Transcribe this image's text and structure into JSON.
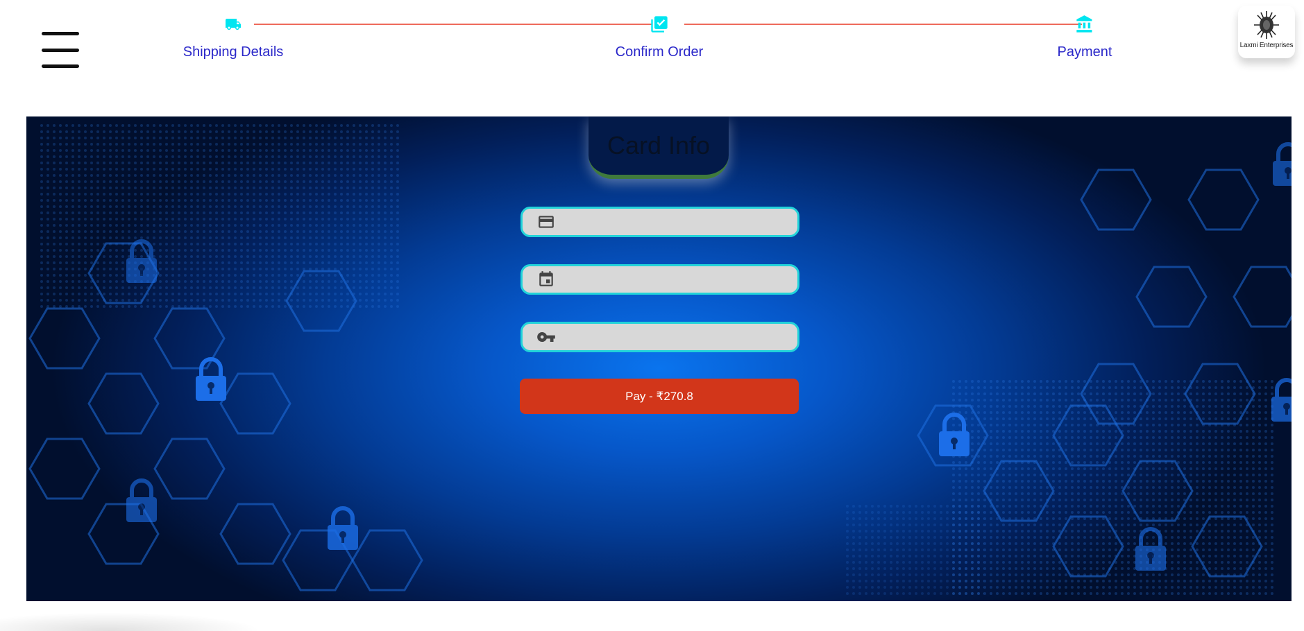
{
  "menu": {
    "icon": "hamburger-menu-icon"
  },
  "stepper": {
    "steps": [
      {
        "label": "Shipping Details",
        "icon": "truck-icon"
      },
      {
        "label": "Confirm Order",
        "icon": "checklist-icon"
      },
      {
        "label": "Payment",
        "icon": "bank-icon"
      }
    ],
    "accent_color": "#00e5f0",
    "label_color": "#2a27c9",
    "connector_color": "#ee6a5b"
  },
  "logo": {
    "text": "Laxmi Enterprises"
  },
  "card": {
    "title": "Card Info",
    "fields": [
      {
        "name": "card-number",
        "icon": "credit-card-icon",
        "value": "",
        "placeholder": ""
      },
      {
        "name": "card-expiry",
        "icon": "calendar-icon",
        "value": "",
        "placeholder": ""
      },
      {
        "name": "card-cvc",
        "icon": "key-icon",
        "value": "",
        "placeholder": ""
      }
    ],
    "pay_button": "Pay - ₹270.8",
    "pay_color": "#d2361a"
  }
}
